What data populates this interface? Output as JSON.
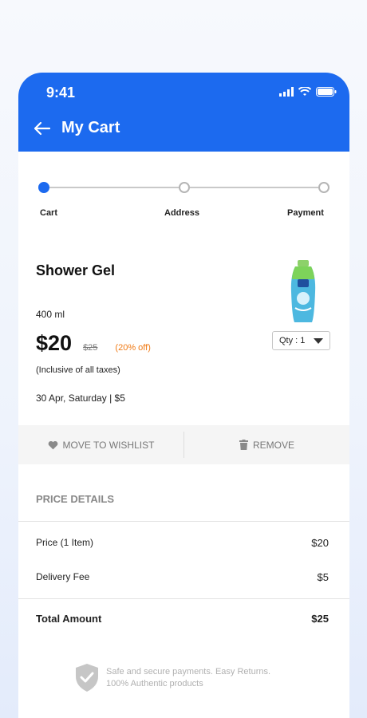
{
  "status_bar": {
    "time": "9:41"
  },
  "header": {
    "title": "My Cart"
  },
  "stepper": {
    "steps": [
      "Cart",
      "Address",
      "Payment"
    ],
    "active_index": 0
  },
  "product": {
    "name": "Shower Gel",
    "size": "400 ml",
    "price": "$20",
    "mrp": "$25",
    "discount": "(20% off)",
    "tax_note": "(Inclusive of all taxes)",
    "delivery": "30 Apr, Saturday | $5",
    "quantity_label": "Qty : 1"
  },
  "actions": {
    "wishlist": "MOVE TO WISHLIST",
    "remove": "REMOVE"
  },
  "price_details": {
    "title": "PRICE DETAILS",
    "rows": [
      {
        "label": "Price (1 Item)",
        "value": "$20"
      },
      {
        "label": "Delivery Fee",
        "value": "$5"
      }
    ],
    "total_label": "Total Amount",
    "total_value": "$25"
  },
  "secure_note": {
    "line1": "Safe and secure payments. Easy Returns.",
    "line2": "100% Authentic products"
  },
  "colors": {
    "accent": "#1c6aef",
    "discount": "#f07a14"
  }
}
